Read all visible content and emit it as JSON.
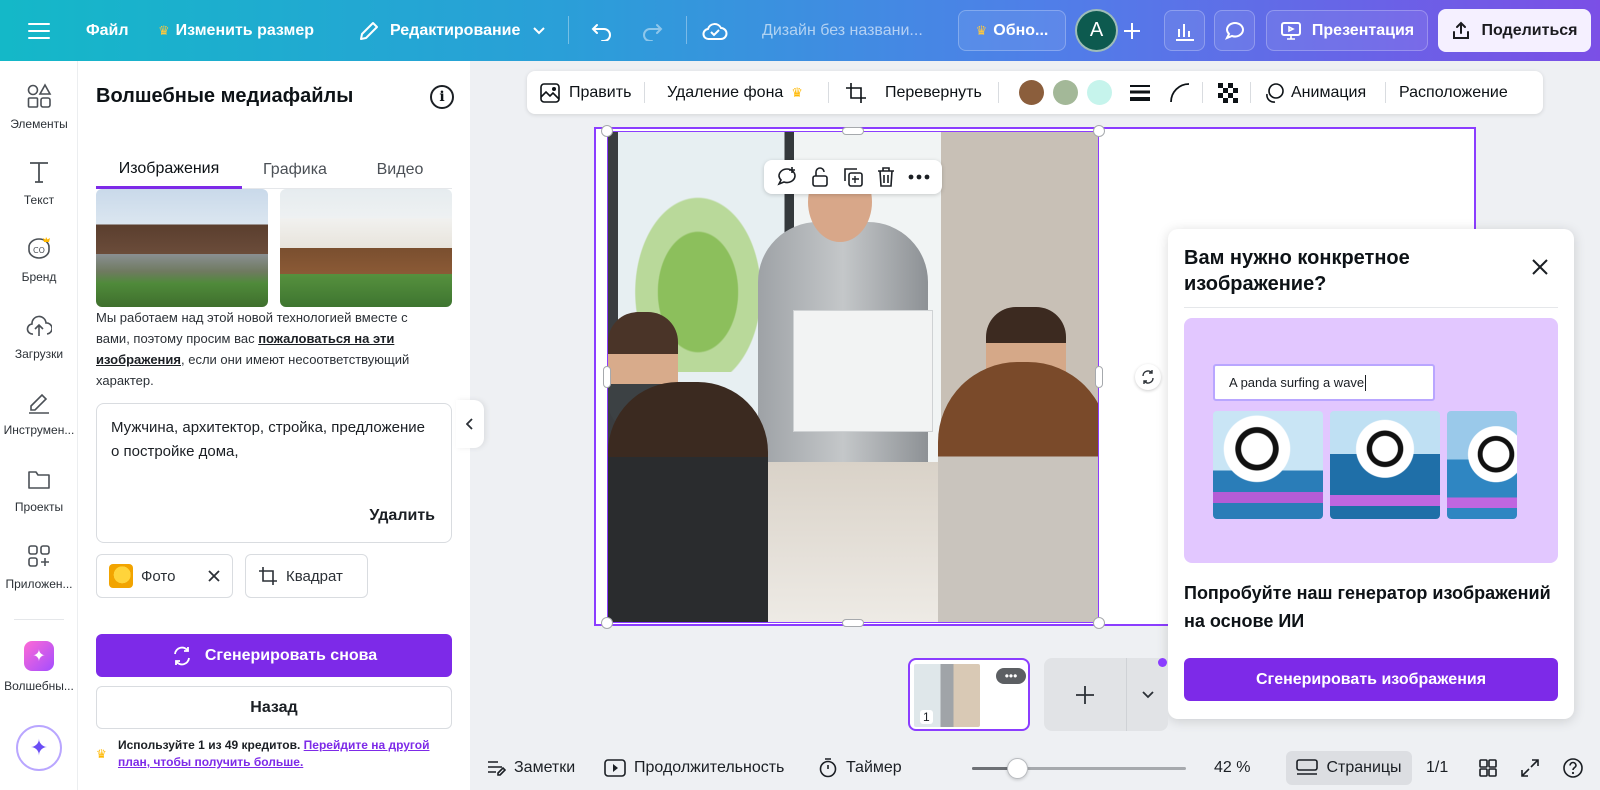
{
  "topbar": {
    "menu_icon": "hamburger-icon",
    "file": "Файл",
    "resize": "Изменить размер",
    "editing": "Редактирование",
    "title": "Дизайн без названи...",
    "upgrade": "Обно...",
    "avatar_letter": "A",
    "present": "Презентация",
    "share": "Поделиться",
    "gradient": [
      "#14b8c8",
      "#7b4fe6"
    ]
  },
  "rail": {
    "items": [
      {
        "label": "Элементы",
        "icon": "shapes-icon"
      },
      {
        "label": "Текст",
        "icon": "text-icon"
      },
      {
        "label": "Бренд",
        "icon": "brand-icon"
      },
      {
        "label": "Загрузки",
        "icon": "upload-cloud-icon"
      },
      {
        "label": "Инструмен...",
        "icon": "pen-icon"
      },
      {
        "label": "Проекты",
        "icon": "folder-icon"
      },
      {
        "label": "Приложен...",
        "icon": "apps-icon"
      },
      {
        "label": "Волшебны...",
        "icon": "magic-media-icon"
      }
    ]
  },
  "panel": {
    "title": "Волшебные медиафайлы",
    "tabs": [
      "Изображения",
      "Графика",
      "Видео"
    ],
    "disclaimer_start": "Мы работаем над этой новой технологией вместе с вами, поэтому просим вас ",
    "disclaimer_link": "пожаловаться на эти изображения",
    "disclaimer_end": ", если они имеют несоответствующий характер.",
    "prompt": "Мужчина, архитектор, стройка, предложение о постройке дома,",
    "prompt_delete": "Удалить",
    "chip_style": "Фото",
    "chip_ratio": "Квадрат",
    "regenerate": "Сгенерировать снова",
    "back": "Назад",
    "credits_text": "Используйте 1 из 49 кредитов. ",
    "credits_link": "Перейдите на другой план, чтобы получить больше.",
    "accent": "#7d2ae8"
  },
  "canvas_toolbar": {
    "edit": "Править",
    "bg_remove": "Удаление фона",
    "flip": "Перевернуть",
    "swatches": [
      "#8b5e3c",
      "#a3b898",
      "#c6f4ec"
    ],
    "animation": "Анимация",
    "position": "Расположение"
  },
  "popup": {
    "title": "Вам нужно конкретное изображение?",
    "example_prompt": "A panda surfing a wave",
    "description": "Попробуйте наш генератор изображений на основе ИИ",
    "button": "Сгенерировать изображения"
  },
  "pages": {
    "thumb_number": "1"
  },
  "bottombar": {
    "notes": "Заметки",
    "duration": "Продолжительность",
    "timer": "Таймер",
    "zoom": "42 %",
    "zoom_value": 42,
    "pages": "Страницы",
    "page_count": "1/1"
  }
}
